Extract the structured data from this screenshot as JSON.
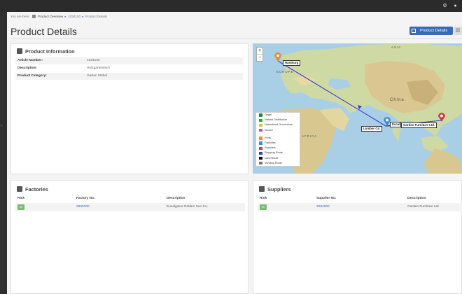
{
  "topbar": {
    "icons": [
      "settings-icon",
      "notification-icon"
    ]
  },
  "breadcrumb": {
    "prefix": "You are here:",
    "items": [
      "Product Overview",
      "1034100",
      "Product Details"
    ]
  },
  "page": {
    "title": "Product Details"
  },
  "toolbar": {
    "view_button_label": "Product Details",
    "chart_button_icon": "bar-chart-icon"
  },
  "product_info": {
    "title": "Product Information",
    "rows": [
      {
        "label": "Article Number:",
        "value": "1034100"
      },
      {
        "label": "Description:",
        "value": "Holzgartentisch"
      },
      {
        "label": "Product Category:",
        "value": "Garten Möbel"
      }
    ]
  },
  "map": {
    "zoom_in": "+",
    "zoom_out": "−",
    "region_labels": {
      "asia": "ASIA",
      "europe": "EUROPE",
      "africa": "AFRICA",
      "china": "China"
    },
    "markers": [
      {
        "label": "Hamburg",
        "color": "#e88a2a"
      },
      {
        "label": "Lumber Co.",
        "color": "#3a8fd6"
      },
      {
        "label": "Escal...",
        "color": "#3a8fd6"
      },
      {
        "label": "Garden Furniture Ltd.",
        "color": "#d63a3a"
      }
    ],
    "legend_top": [
      {
        "label": "Origin",
        "color": "#1a8f3a"
      },
      {
        "label": "Natural Distribution",
        "color": "#2aaf2a"
      },
      {
        "label": "Naturalized Occurrence",
        "color": "#b8d82a"
      },
      {
        "label": "Source",
        "color": "#c84fc8"
      }
    ],
    "legend_bottom": [
      {
        "label": "Ports",
        "color": "#f0902a"
      },
      {
        "label": "Factories",
        "color": "#3a8fd6"
      },
      {
        "label": "Suppliers",
        "color": "#d63a3a"
      },
      {
        "label": "Shipping Route",
        "color": "#3a3ad6"
      },
      {
        "label": "Land Route",
        "color": "#111111"
      },
      {
        "label": "Vending Route",
        "color": "#777777"
      }
    ]
  },
  "factories": {
    "title": "Factories",
    "columns": [
      "Risk",
      "Factory No.",
      "Description"
    ],
    "rows": [
      {
        "risk": "50",
        "number": "2865300",
        "description": "Eucalyptus Golden Sun Co."
      }
    ]
  },
  "suppliers": {
    "title": "Suppliers",
    "columns": [
      "Risk",
      "Supplier No.",
      "Description"
    ],
    "rows": [
      {
        "risk": "50",
        "number": "3284600",
        "description": "Garden Furniture Ltd."
      }
    ]
  }
}
